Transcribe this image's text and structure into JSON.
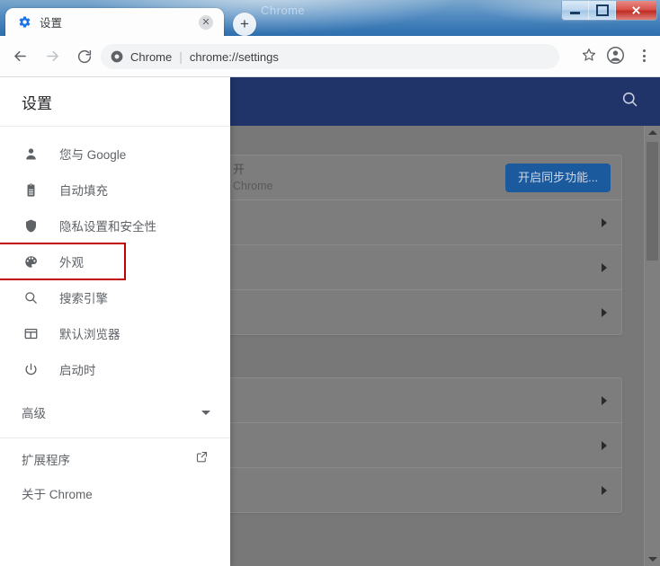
{
  "window": {
    "ghost_title": "Chrome",
    "controls": {
      "minimize": "–",
      "maximize": "□",
      "close": "✕"
    }
  },
  "tab": {
    "title": "设置",
    "favicon": "settings-gear-icon",
    "close_label": "✕",
    "new_tab_label": "+"
  },
  "toolbar": {
    "back": "←",
    "forward": "→",
    "reload": "↻",
    "omnibox": {
      "scheme_label": "Chrome",
      "separator": "|",
      "url": "chrome://settings",
      "site_icon": "chrome-logo-icon"
    },
    "star": "☆",
    "profile": "profile-avatar-icon",
    "menu": "three-dot-menu-icon"
  },
  "sidebar": {
    "title": "设置",
    "items": [
      {
        "label": "您与 Google",
        "icon": "person-icon",
        "highlighted": false
      },
      {
        "label": "自动填充",
        "icon": "clipboard-icon",
        "highlighted": false
      },
      {
        "label": "隐私设置和安全性",
        "icon": "shield-icon",
        "highlighted": false
      },
      {
        "label": "外观",
        "icon": "palette-icon",
        "highlighted": true
      },
      {
        "label": "搜索引擎",
        "icon": "search-icon",
        "highlighted": false
      },
      {
        "label": "默认浏览器",
        "icon": "browser-window-icon",
        "highlighted": false
      },
      {
        "label": "启动时",
        "icon": "power-icon",
        "highlighted": false
      }
    ],
    "advanced": {
      "label": "高级",
      "caret": "chevron-down-icon"
    },
    "footer": [
      {
        "label": "扩展程序",
        "icon": "external-link-icon"
      },
      {
        "label": "关于 Chrome",
        "icon": ""
      }
    ],
    "highlight_color": "#c00000"
  },
  "content": {
    "header": {
      "background_color": "#203469",
      "search_icon": "search-icon"
    },
    "overlay_color": "#787878",
    "cards": [
      {
        "rows": [
          {
            "line1": "开",
            "line2": "Chrome",
            "button": "开启同步功能...",
            "chevron": false
          },
          {
            "line1": "",
            "line2": "",
            "button": "",
            "chevron": true
          },
          {
            "line1": "",
            "line2": "",
            "button": "",
            "chevron": true
          },
          {
            "line1": "",
            "line2": "",
            "button": "",
            "chevron": true
          }
        ]
      },
      {
        "rows": [
          {
            "line1": "",
            "line2": "",
            "button": "",
            "chevron": true
          },
          {
            "line1": "",
            "line2": "",
            "button": "",
            "chevron": true
          },
          {
            "line1": "",
            "line2": "",
            "button": "",
            "chevron": true
          }
        ]
      }
    ],
    "sync_button_color": "#1c5a9e",
    "scrollbar": {
      "up_arrow": "▲",
      "down_arrow": "▼"
    }
  }
}
